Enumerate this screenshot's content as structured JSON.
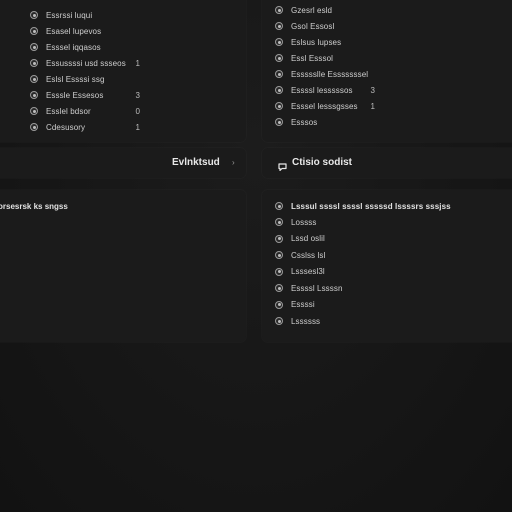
{
  "left_top": {
    "items": [
      {
        "label": "Essrssi luqui",
        "count": ""
      },
      {
        "label": "Esasel lupevos",
        "count": ""
      },
      {
        "label": "Esssel iqqasos",
        "count": ""
      },
      {
        "label": "Essussssi usd ssseos",
        "count": "1"
      },
      {
        "label": "Eslsl Essssi ssg",
        "count": ""
      },
      {
        "label": "Esssle Essesos",
        "count": "3"
      },
      {
        "label": "Esslel bdsor",
        "count": "0"
      },
      {
        "label": "Cdesusory",
        "count": "1"
      }
    ]
  },
  "right_top": {
    "items": [
      {
        "label": "Gzesrl esld",
        "count": ""
      },
      {
        "label": "Gsol Essosl",
        "count": ""
      },
      {
        "label": "Eslsus lupses",
        "count": ""
      },
      {
        "label": "Essl Esssol",
        "count": ""
      },
      {
        "label": "Essssslle Esssssssel",
        "count": ""
      },
      {
        "label": "Essssl lesssssos",
        "count": "3"
      },
      {
        "label": "Esssel lesssgsses",
        "count": "1"
      },
      {
        "label": "Esssos",
        "count": ""
      }
    ]
  },
  "left_bar": {
    "title": "Evlnktsud"
  },
  "right_bar": {
    "title": "Ctisio sodist"
  },
  "left_bottom": {
    "heading": "orsesrsk ks sngss"
  },
  "right_bottom": {
    "heading": "Lsssul ssssl ssssl sssssd lssssrs sssjss",
    "items": [
      {
        "label": "Lossss"
      },
      {
        "label": "Lssd oslil"
      },
      {
        "label": "Csslss lsl"
      },
      {
        "label": "Lsssesl3l"
      },
      {
        "label": "Essssl Lssssn"
      },
      {
        "label": "Essssi"
      },
      {
        "label": "Lssssss"
      }
    ]
  },
  "colors": {
    "background": "#161616",
    "panel": "#1b1b1b",
    "text": "#cfcfcf",
    "radio_border": "#9a9a9a"
  }
}
